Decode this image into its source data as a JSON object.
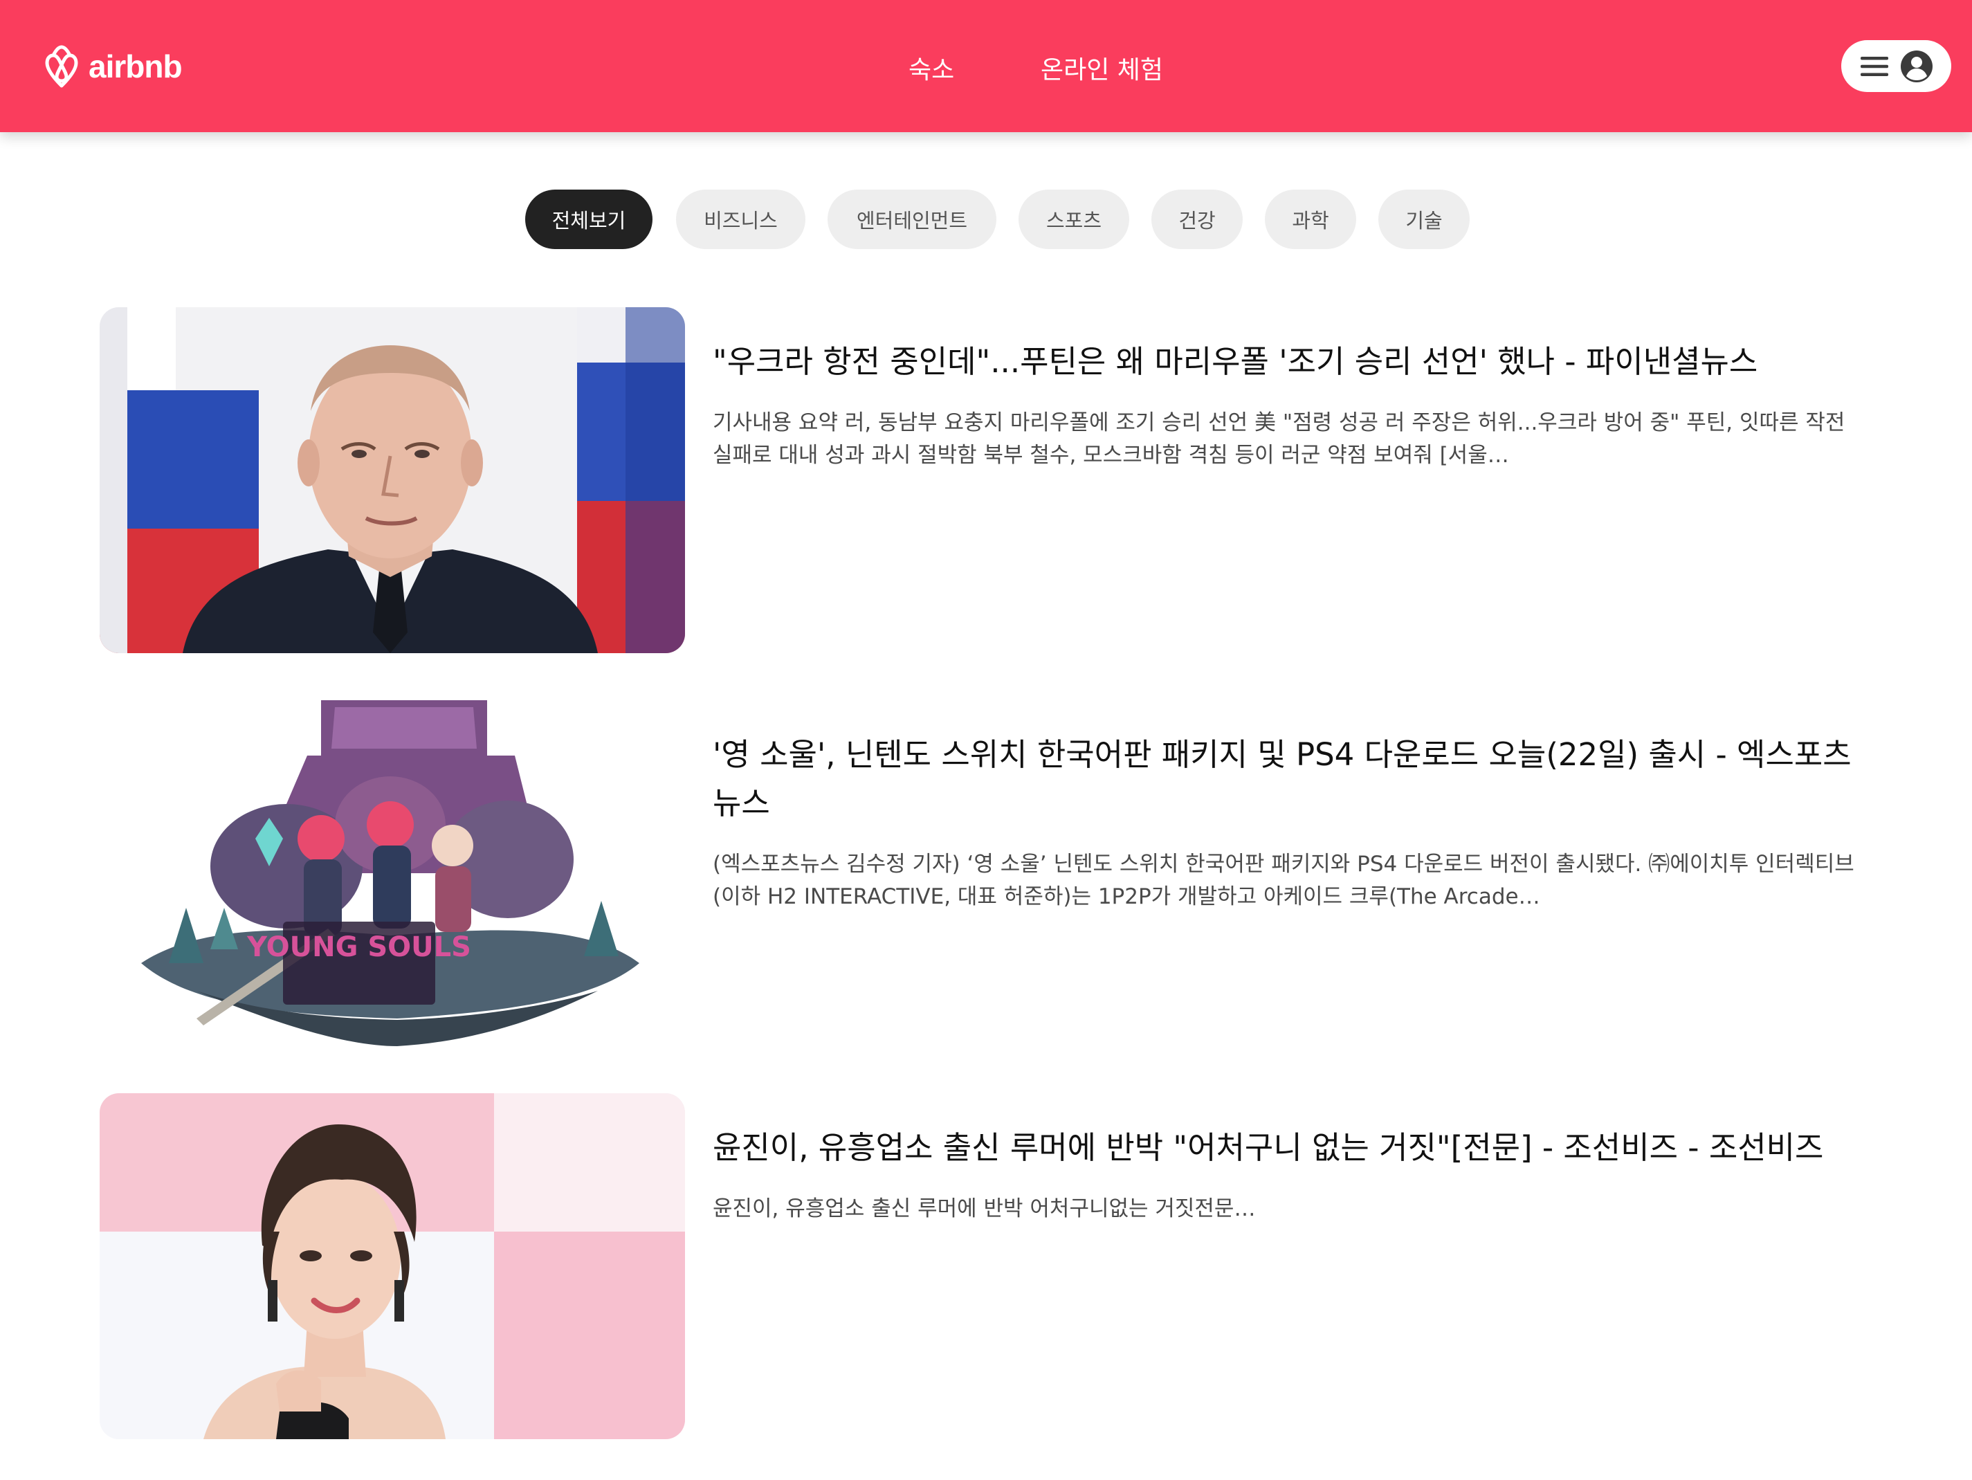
{
  "header": {
    "brand": "airbnb",
    "logo_icon": "airbnb-belo-icon",
    "nav": [
      {
        "label": "숙소"
      },
      {
        "label": "온라인 체험"
      }
    ],
    "menu_icon": "hamburger-menu-icon",
    "profile_icon": "user-avatar-icon",
    "brand_color": "#fa3d5d"
  },
  "categories": [
    {
      "label": "전체보기",
      "active": true
    },
    {
      "label": "비즈니스",
      "active": false
    },
    {
      "label": "엔터테인먼트",
      "active": false
    },
    {
      "label": "스포츠",
      "active": false
    },
    {
      "label": "건강",
      "active": false
    },
    {
      "label": "과학",
      "active": false
    },
    {
      "label": "기술",
      "active": false
    }
  ],
  "articles": [
    {
      "title": "\"우크라 항전 중인데\"...푸틴은 왜 마리우폴 '조기 승리 선언' 했나 - 파이낸셜뉴스",
      "description": "기사내용 요약 러, 동남부 요충지 마리우폴에 조기 승리 선언 美 \"점령 성공 러 주장은 허위...우크라 방어 중\" 푸틴, 잇따른 작전 실패로 대내 성과 과시 절박함 북부 철수, 모스크바함 격침 등이 러군 약점 보여줘 [서울…",
      "image": "news-photo-politician"
    },
    {
      "title": "'영 소울', 닌텐도 스위치 한국어판 패키지 및 PS4 다운로드 오늘(22일) 출시 - 엑스포츠뉴스",
      "description": "(엑스포츠뉴스 김수정 기자) ‘영 소울’ 닌텐도 스위치 한국어판 패키지와 PS4 다운로드 버전이 출시됐다. ㈜에이치투 인터렉티브(이하 H2 INTERACTIVE, 대표 허준하)는 1P2P가 개발하고 아케이드 크루(The Arcade…",
      "image": "game-key-art",
      "image_text": "YOUNG SOULS"
    },
    {
      "title": "윤진이, 유흥업소 출신 루머에 반박 \"어처구니 없는 거짓\"[전문] - 조선비즈 - 조선비즈",
      "description": "윤진이, 유흥업소 출신 루머에 반박 어처구니없는 거짓전문…",
      "image": "news-photo-actress"
    }
  ]
}
